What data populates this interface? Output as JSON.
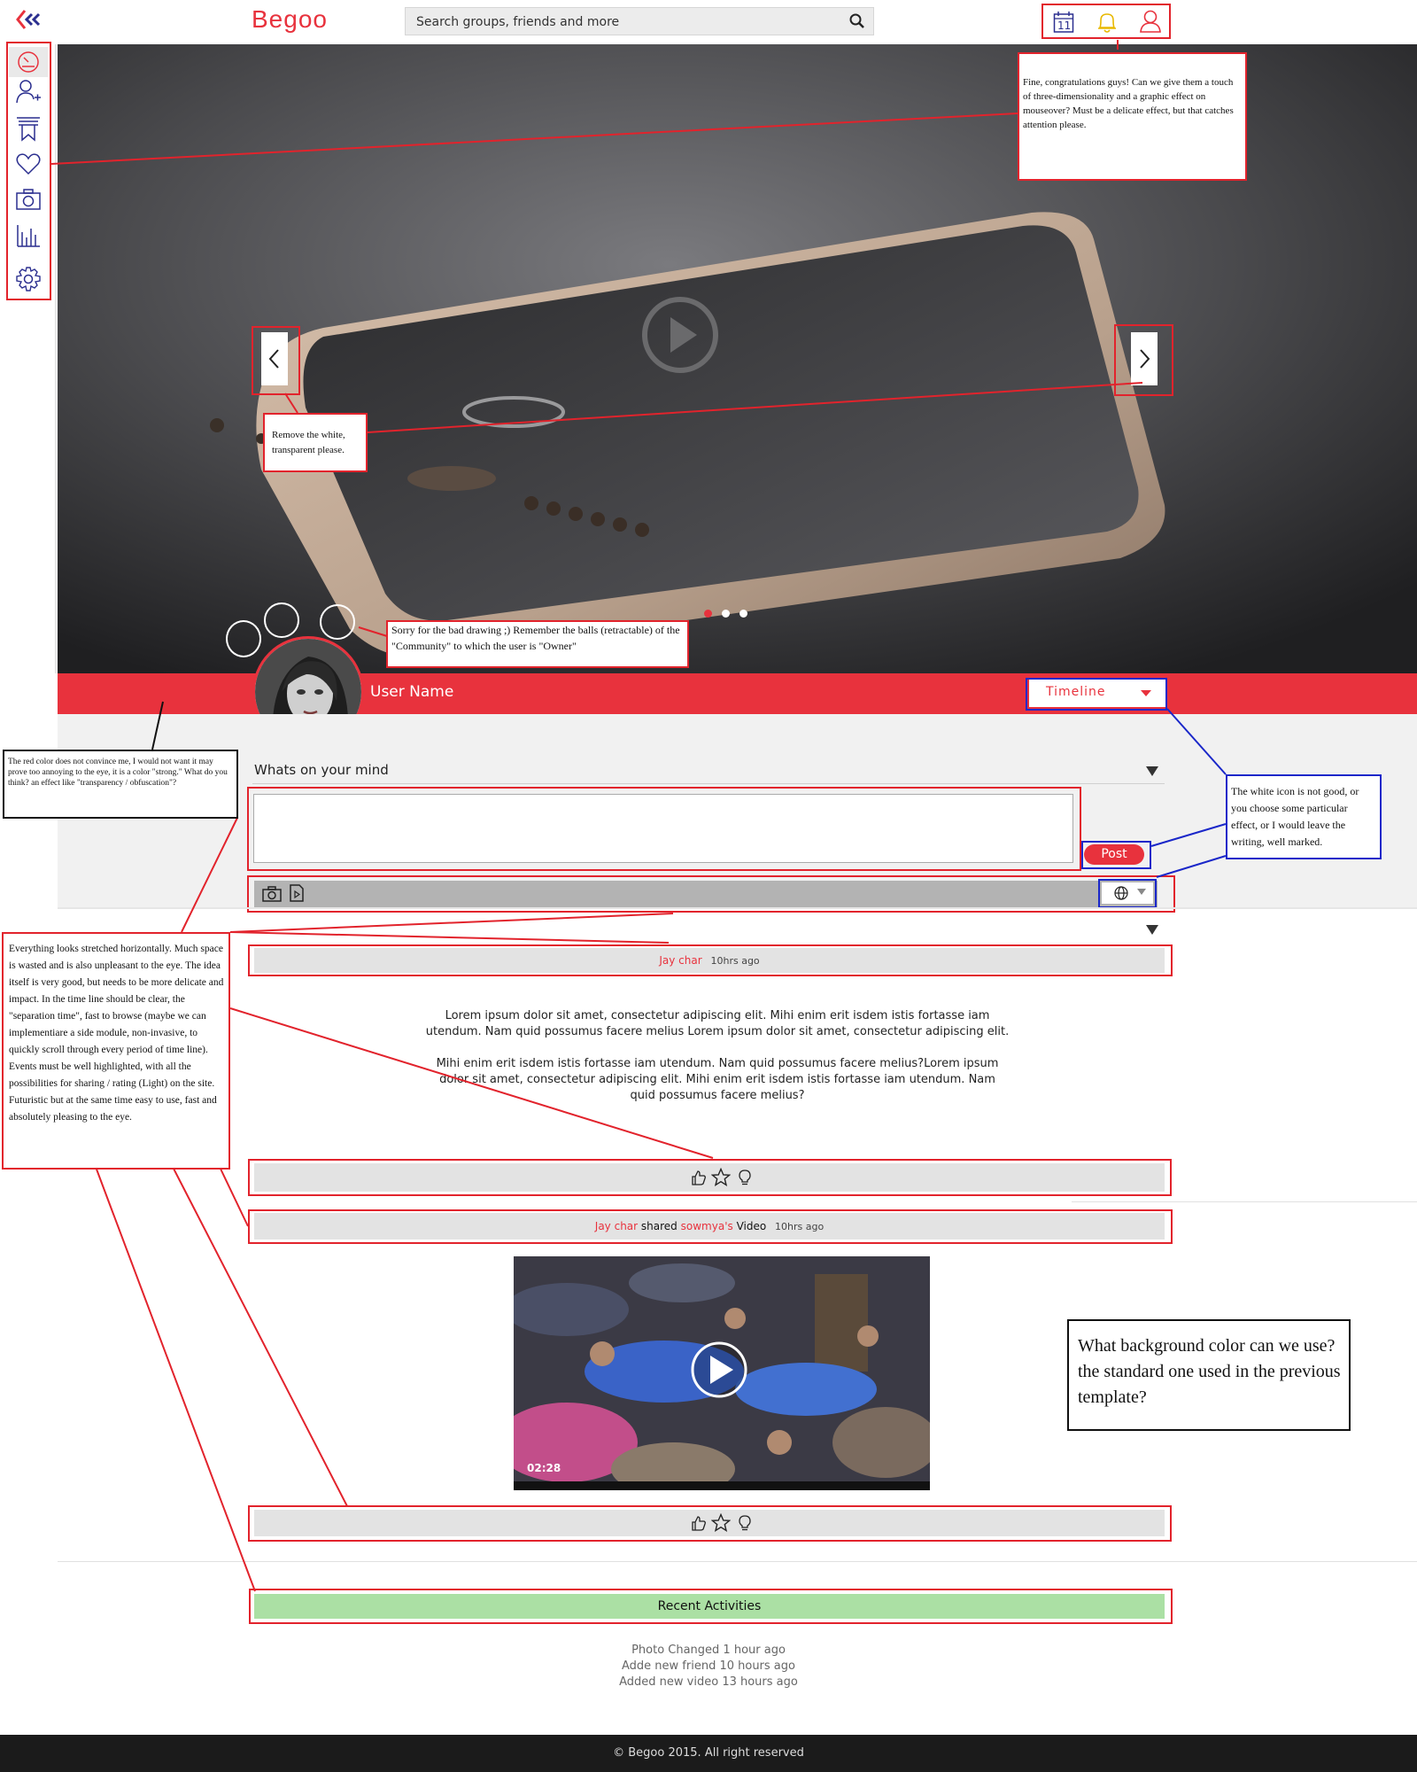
{
  "app": {
    "logo_text": "Begoo"
  },
  "search": {
    "placeholder": "Search groups, friends and more"
  },
  "header_icons": {
    "calendar_day": "11"
  },
  "profile": {
    "name": "User Name",
    "view_select": "Timeline"
  },
  "composer": {
    "label": "Whats on your mind",
    "post_label": "Post"
  },
  "posts": [
    {
      "author": "Jay char",
      "time": "10hrs ago",
      "paragraph1": "Lorem ipsum dolor sit amet, consectetur adipiscing elit. Mihi enim erit isdem istis fortasse iam utendum. Nam quid possumus facere melius Lorem ipsum dolor sit amet, consectetur adipiscing elit.",
      "paragraph2": "Mihi enim erit isdem istis fortasse iam utendum. Nam quid possumus facere melius?Lorem ipsum dolor sit amet, consectetur adipiscing elit. Mihi enim erit isdem istis fortasse iam utendum. Nam quid possumus facere melius?"
    },
    {
      "author": "Jay char",
      "verb": "shared",
      "target": "sowmya's",
      "object": "Video",
      "time": "10hrs ago",
      "video_duration": "02:28"
    }
  ],
  "recent": {
    "title": "Recent Activities",
    "items": [
      "Photo Changed 1 hour ago",
      "Adde new friend 10 hours ago",
      "Added new video 13 hours ago"
    ]
  },
  "footer": {
    "text": "© Begoo 2015. All right reserved"
  },
  "annotations": {
    "header_icons": "Fine, congratulations guys! Can we give them a touch of three-dimensionality and a graphic effect on mouseover? Must be a delicate effect, but that catches attention please.",
    "arrows": "Remove the white, transparent please.",
    "balls": "Sorry for the bad drawing ;) Remember the balls (retractable) of the \"Community\" to which the user is \"Owner\"",
    "red_color": "The red color does not convince me, I would not want it may prove too annoying to the eye, it is a color \"strong.\" What do you think? an effect like \"transparency / obfuscation\"?",
    "white_icon": "The white icon is not good, or you choose some particular effect, or I would leave the writing, well marked.",
    "stretched": "Everything looks stretched horizontally. Much space is wasted and is also unpleasant to the eye. The idea itself is very good, but needs to be more delicate and impact. In the time line should be clear, the \"separation time\", fast to browse (maybe we can implementiare a side module, non-invasive, to quickly scroll through every period of time line). Events must be well highlighted, with all the possibilities for sharing / rating (Light) on the site. Futuristic but at the same time easy to use, fast and absolutely pleasing to the eye.",
    "background": "What background color can we use? the standard one used in the previous template?"
  },
  "colors": {
    "brand_red": "#e8323d",
    "annotation_red": "#e2232c",
    "annotation_blue": "#1a27c9",
    "icon_blue": "#2b2f8f",
    "recent_green": "#abe0a4"
  }
}
